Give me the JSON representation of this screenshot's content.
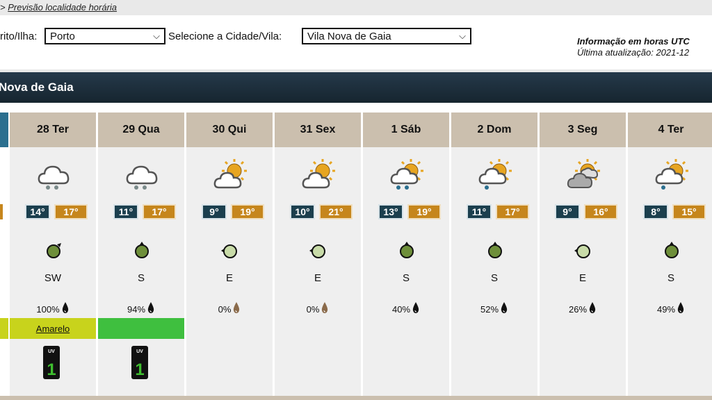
{
  "breadcrumb": {
    "prefix": ">",
    "link": "Previsão localidade horária"
  },
  "filters": {
    "district_label": "rito/Ilha:",
    "district_value": "Porto",
    "city_label": "Selecione a Cidade/Vila:",
    "city_value": "Vila Nova de Gaia"
  },
  "info": {
    "utc": "Informação em horas UTC",
    "updated": "Última atualização: 2021-12"
  },
  "city_bar": "Nova de Gaia",
  "colors": {
    "dark": "#1b3f4e",
    "accent": "#c6861c",
    "header": "#cbbfae",
    "warn_yellow": "#c8d31c",
    "warn_green": "#3fbf3f"
  },
  "days": [
    {
      "day": "28 Ter",
      "icon": "cloud-rain-icon",
      "tmin": "14°",
      "tmax": "17°",
      "wind_icon": "wind-arrow-sw-icon",
      "wind_dir": "SW",
      "precip": "100%",
      "warning": "Amarelo",
      "warning_color": "#c8d31c",
      "uv": "1",
      "uv_label": "UV"
    },
    {
      "day": "29 Qua",
      "icon": "cloud-rain-icon",
      "tmin": "11°",
      "tmax": "17°",
      "wind_icon": "wind-arrow-s-icon",
      "wind_dir": "S",
      "precip": "94%",
      "warning": "",
      "warning_color": "#3fbf3f",
      "uv": "1",
      "uv_label": "UV"
    },
    {
      "day": "30 Qui",
      "icon": "sun-cloud-icon",
      "tmin": "9°",
      "tmax": "19°",
      "wind_icon": "wind-arrow-e-icon",
      "wind_dir": "E",
      "precip": "0%",
      "warning": "",
      "warning_color": "",
      "uv": "",
      "uv_label": ""
    },
    {
      "day": "31 Sex",
      "icon": "sun-cloud-icon",
      "tmin": "10°",
      "tmax": "21°",
      "wind_icon": "wind-arrow-e-icon",
      "wind_dir": "E",
      "precip": "0%",
      "warning": "",
      "warning_color": "",
      "uv": "",
      "uv_label": ""
    },
    {
      "day": "1 Sáb",
      "icon": "sun-cloud-rain-icon",
      "tmin": "13°",
      "tmax": "19°",
      "wind_icon": "wind-arrow-s-icon",
      "wind_dir": "S",
      "precip": "40%",
      "warning": "",
      "warning_color": "",
      "uv": "",
      "uv_label": ""
    },
    {
      "day": "2 Dom",
      "icon": "sun-cloud-drizzle-icon",
      "tmin": "11°",
      "tmax": "17°",
      "wind_icon": "wind-arrow-s-icon",
      "wind_dir": "S",
      "precip": "52%",
      "warning": "",
      "warning_color": "",
      "uv": "",
      "uv_label": ""
    },
    {
      "day": "3 Seg",
      "icon": "sun-clouds-icon",
      "tmin": "9°",
      "tmax": "16°",
      "wind_icon": "wind-arrow-e-icon",
      "wind_dir": "E",
      "precip": "26%",
      "warning": "",
      "warning_color": "",
      "uv": "",
      "uv_label": ""
    },
    {
      "day": "4 Ter",
      "icon": "sun-cloud-drizzle-icon",
      "tmin": "8°",
      "tmax": "15°",
      "wind_icon": "wind-arrow-s-icon",
      "wind_dir": "S",
      "precip": "49%",
      "warning": "",
      "warning_color": "",
      "uv": "",
      "uv_label": ""
    }
  ]
}
